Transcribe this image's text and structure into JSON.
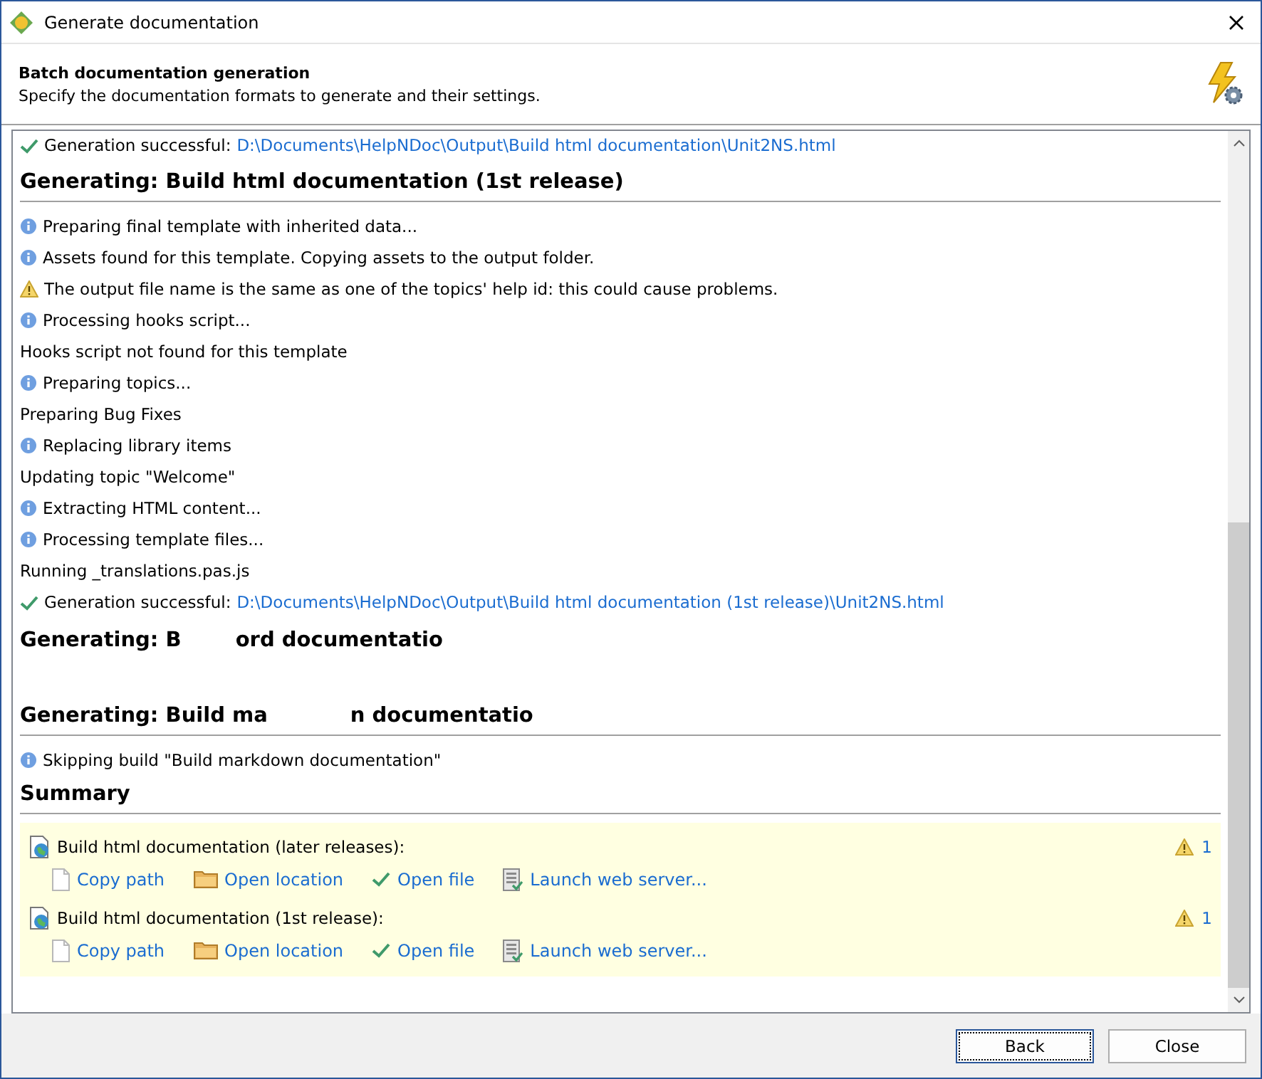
{
  "window": {
    "title": "Generate documentation"
  },
  "header": {
    "title": "Batch documentation generation",
    "subtitle": "Specify the documentation formats to generate and their settings."
  },
  "log": [
    {
      "kind": "success",
      "text": "Generation successful:",
      "path": "D:\\Documents\\HelpNDoc\\Output\\Build html documentation\\Unit2NS.html"
    },
    {
      "kind": "heading",
      "text": "Generating: Build html documentation (1st release)"
    },
    {
      "kind": "info",
      "text": "Preparing final template with inherited data..."
    },
    {
      "kind": "info",
      "text": "Assets found for this template. Copying assets to the output folder."
    },
    {
      "kind": "warning",
      "text": "The output file name is the same as one of the topics' help id: this could cause problems."
    },
    {
      "kind": "info",
      "text": "Processing hooks script..."
    },
    {
      "kind": "plain",
      "text": "Hooks script not found for this template"
    },
    {
      "kind": "info",
      "text": "Preparing topics..."
    },
    {
      "kind": "plain",
      "text": "Preparing Bug Fixes"
    },
    {
      "kind": "info",
      "text": "Replacing library items"
    },
    {
      "kind": "plain",
      "text": "Updating topic \"Welcome\""
    },
    {
      "kind": "info",
      "text": "Extracting HTML content..."
    },
    {
      "kind": "info",
      "text": "Processing template files..."
    },
    {
      "kind": "plain",
      "text": "Running _translations.pas.js"
    },
    {
      "kind": "success",
      "text": "Generation successful:",
      "path": "D:\\Documents\\HelpNDoc\\Output\\Build html documentation (1st release)\\Unit2NS.html"
    },
    {
      "kind": "torn",
      "parts": [
        "Generating: B",
        "ord documentatio"
      ]
    },
    {
      "kind": "torn-ruled",
      "parts": [
        "Generating: Build ma",
        "n documentatio"
      ]
    },
    {
      "kind": "info",
      "text": "Skipping build \"Build markdown documentation\""
    }
  ],
  "summary": {
    "title": "Summary",
    "items": [
      {
        "title": "Build html documentation (later releases):",
        "warnings": "1",
        "actions": [
          {
            "kind": "copy",
            "label": "Copy path"
          },
          {
            "kind": "folder",
            "label": "Open location"
          },
          {
            "kind": "check",
            "label": "Open file"
          },
          {
            "kind": "server",
            "label": "Launch web server..."
          }
        ]
      },
      {
        "title": "Build html documentation (1st release):",
        "warnings": "1",
        "actions": [
          {
            "kind": "copy",
            "label": "Copy path"
          },
          {
            "kind": "folder",
            "label": "Open location"
          },
          {
            "kind": "check",
            "label": "Open file"
          },
          {
            "kind": "server",
            "label": "Launch web server..."
          }
        ]
      }
    ]
  },
  "buttons": [
    {
      "label": "Back",
      "focused": true
    },
    {
      "label": "Close",
      "focused": false
    }
  ]
}
